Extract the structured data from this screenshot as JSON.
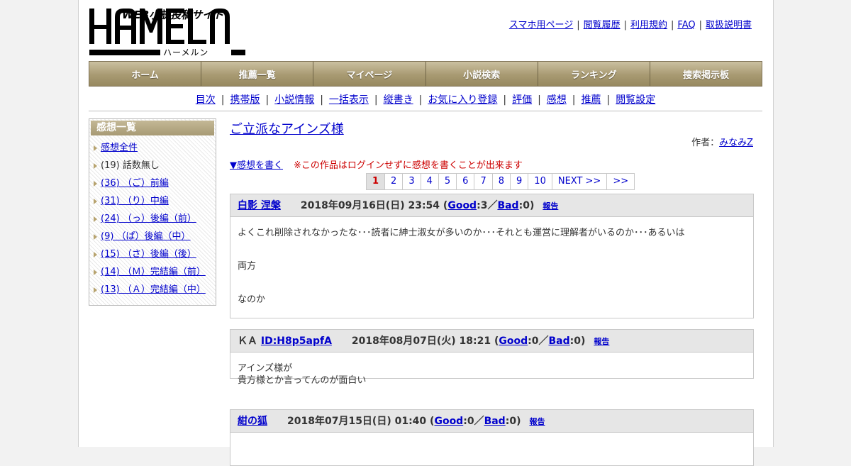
{
  "header": {
    "tagline": "WEB小説投稿サイト",
    "brand": "HAMELN",
    "brand_kana": "ハーメルン",
    "links": [
      "スマホ用ページ",
      "閲覧履歴",
      "利用規約",
      "FAQ",
      "取扱説明書"
    ]
  },
  "main_nav": [
    "ホーム",
    "推薦一覧",
    "マイページ",
    "小説検索",
    "ランキング",
    "捜索掲示板"
  ],
  "sub_nav": [
    "目次",
    "携帯版",
    "小説情報",
    "一括表示",
    "縦書き",
    "お気に入り登録",
    "評価",
    "感想",
    "推薦",
    "閲覧設定"
  ],
  "sidebar": {
    "title": "感想一覧",
    "items": [
      {
        "label": "感想全件",
        "link": true
      },
      {
        "label": "(19) 話数無し",
        "link": false
      },
      {
        "label": "(36) （ご）前編",
        "link": true
      },
      {
        "label": "(31) （り）中編",
        "link": true
      },
      {
        "label": "(24) （っ）後編（前）",
        "link": true
      },
      {
        "label": "(9) （ぱ）後編（中）",
        "link": true
      },
      {
        "label": "(15) （さ）後編（後）",
        "link": true
      },
      {
        "label": "(14) （Ｍ）完結編（前）",
        "link": true
      },
      {
        "label": "(13) （Ａ）完結編（中）",
        "link": true
      }
    ]
  },
  "work": {
    "title": "ご立派なアインズ様",
    "author_label": "作者：",
    "author_name": "みなみZ",
    "write_link": "▼感想を書く",
    "notice": "※この作品はログインせずに感想を書くことが出来ます"
  },
  "pager": {
    "pages": [
      "1",
      "2",
      "3",
      "4",
      "5",
      "6",
      "7",
      "8",
      "9",
      "10",
      "NEXT >>",
      ">>"
    ],
    "current": "1"
  },
  "reviews": [
    {
      "prefix": "",
      "user": "白影 涅槃",
      "date": "2018年09月16日(日) 23:54",
      "good_label": "Good",
      "good_count": "3",
      "bad_label": "Bad",
      "bad_count": "0",
      "report": "報告",
      "lines": [
        "よくこれ削除されなかったな･･･読者に紳士淑女が多いのか･･･それとも運営に理解者がいるのか･･･あるいは",
        "両方",
        "なのか"
      ]
    },
    {
      "prefix": "ＫＡ",
      "user": "ID:H8p5apfA",
      "date": "2018年08月07日(火) 18:21",
      "good_label": "Good",
      "good_count": "0",
      "bad_label": "Bad",
      "bad_count": "0",
      "report": "報告",
      "lines": [
        "アインズ様が",
        "貴方様とか言ってんのが面白い"
      ]
    },
    {
      "prefix": "",
      "user": "紺の狐",
      "date": "2018年07月15日(日) 01:40",
      "good_label": "Good",
      "good_count": "0",
      "bad_label": "Bad",
      "bad_count": "0",
      "report": "報告",
      "lines": []
    }
  ],
  "colors": {
    "nav_gradient_top": "#cbc0a0",
    "nav_gradient_bottom": "#978960",
    "link": "#0000cc",
    "notice": "#cc0000"
  }
}
